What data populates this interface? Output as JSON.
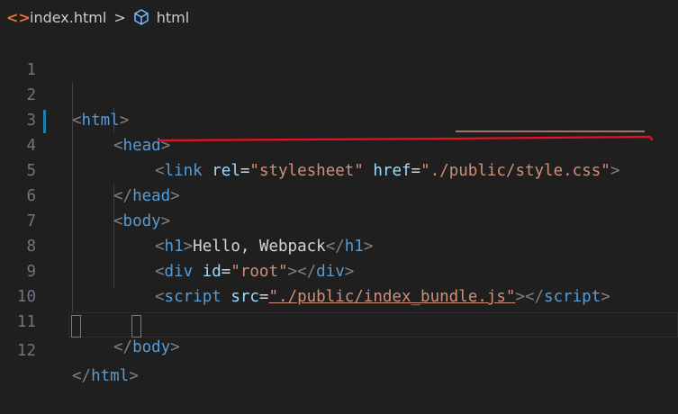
{
  "breadcrumb": {
    "file_icon": "<>",
    "file_name": "index.html",
    "separator": ">",
    "symbol_icon": "cube-symbol-icon",
    "symbol_name": "html"
  },
  "colors": {
    "background": "#1f1f1f",
    "tag": "#569cd6",
    "attribute": "#9cdcfe",
    "string": "#ce9178",
    "bracket": "#808080",
    "line_number": "#6e7681",
    "modified_indicator": "#1b81a8",
    "annotation": "#e81123"
  },
  "editor": {
    "line_numbers": [
      "1",
      "2",
      "3",
      "4",
      "5",
      "6",
      "7",
      "8",
      "9",
      "10",
      "11",
      "12"
    ],
    "lines": {
      "l2": {
        "lt": "<",
        "tag": "html",
        "gt": ">"
      },
      "l3": {
        "lt": "<",
        "tag": "head",
        "gt": ">"
      },
      "l4": {
        "lt": "<",
        "tag": "link",
        "attr1": "rel",
        "eq1": "=",
        "val1": "\"stylesheet\"",
        "attr2": "href",
        "eq2": "=",
        "val2": "\"./public/style.css\"",
        "gt": ">"
      },
      "l5": {
        "lt": "</",
        "tag": "head",
        "gt": ">"
      },
      "l6": {
        "lt": "<",
        "tag": "body",
        "gt": ">"
      },
      "l7": {
        "lt": "<",
        "tag": "h1",
        "gt": ">",
        "text": "Hello, Webpack",
        "lt2": "</",
        "tag2": "h1",
        "gt2": ">"
      },
      "l8": {
        "lt": "<",
        "tag": "div",
        "attr1": "id",
        "eq1": "=",
        "val1": "\"root\"",
        "gt": ">",
        "lt2": "</",
        "tag2": "div",
        "gt2": ">"
      },
      "l9": {
        "lt": "<",
        "tag": "script",
        "attr1": "src",
        "eq1": "=",
        "val1": "\"./public/index_bundle.js\"",
        "gt": ">",
        "lt2": "</",
        "tag2": "script",
        "gt2": ">"
      },
      "l11": {
        "lt": "</",
        "tag": "body",
        "gt": ">"
      },
      "l12": {
        "lt": "</",
        "tag": "html",
        "gt": ">"
      }
    }
  }
}
